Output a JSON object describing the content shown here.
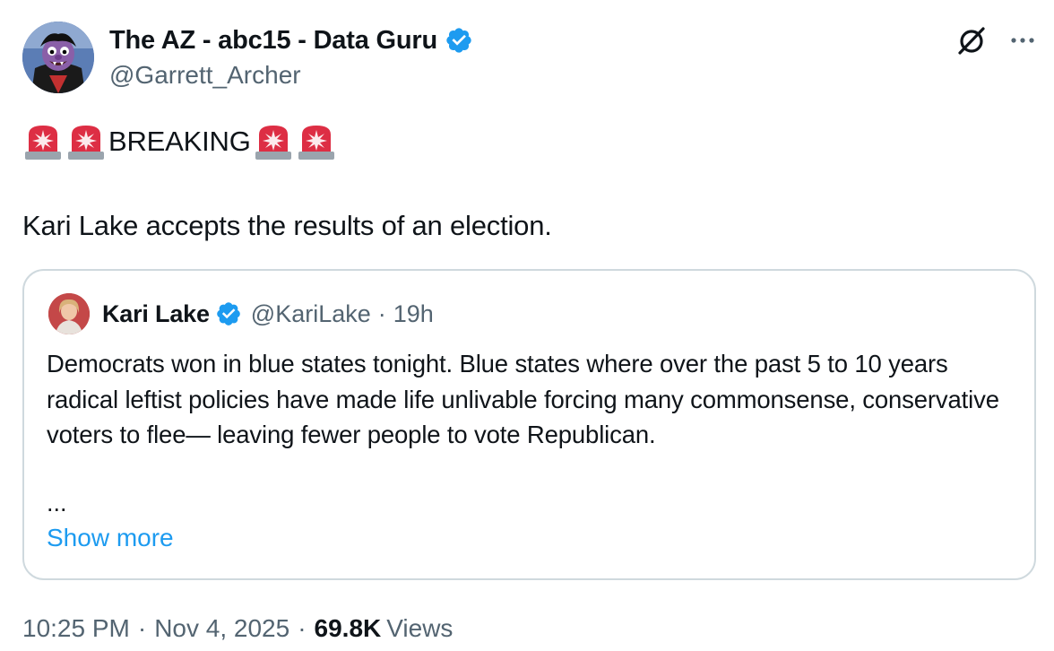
{
  "author": {
    "display_name": "The AZ - abc15 - Data Guru",
    "handle": "@Garrett_Archer",
    "verified": true,
    "avatar_icon": "avatar-count-character-icon"
  },
  "actions": {
    "grok_icon": "grok-icon",
    "more_icon": "more-icon"
  },
  "tweet": {
    "breaking_text": "BREAKING",
    "emoji_name": "police-car-light",
    "body": "Kari Lake accepts the results of an election."
  },
  "quote": {
    "display_name": "Kari Lake",
    "handle": "@KariLake",
    "separator": "·",
    "time": "19h",
    "verified": true,
    "body": "Democrats won in blue states tonight. Blue states where over the past 5 to 10 years radical leftist policies have made life unlivable forcing many commonsense, conservative voters to flee— leaving fewer people to vote Republican.",
    "ellipsis": "...",
    "show_more": "Show more"
  },
  "meta": {
    "time": "10:25 PM",
    "separator": "·",
    "date": "Nov 4, 2025",
    "views_count": "69.8K",
    "views_label": "Views"
  },
  "colors": {
    "text_primary": "#0f1419",
    "text_secondary": "#536471",
    "link": "#1d9bf0",
    "verified": "#1d9bf0",
    "border": "#cfd9de"
  }
}
